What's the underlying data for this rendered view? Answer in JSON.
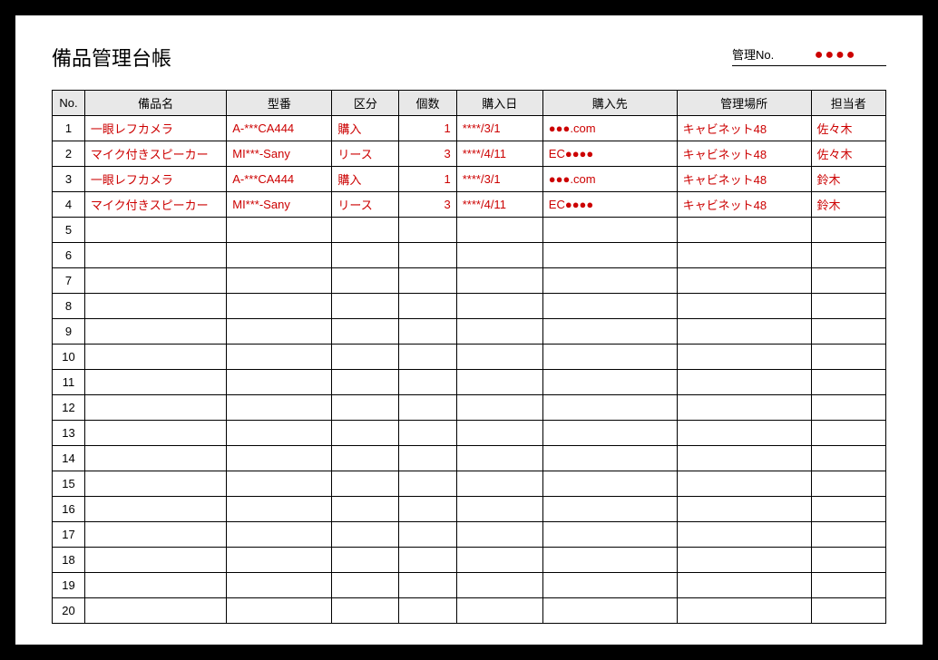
{
  "title": "備品管理台帳",
  "management_no_label": "管理No.",
  "management_no_value": "●●●●",
  "headers": {
    "no": "No.",
    "name": "備品名",
    "model": "型番",
    "category": "区分",
    "qty": "個数",
    "date": "購入日",
    "shop": "購入先",
    "location": "管理場所",
    "owner": "担当者"
  },
  "total_rows": 20,
  "rows": [
    {
      "no": "1",
      "name": "一眼レフカメラ",
      "model": "A-***CA444",
      "category": "購入",
      "qty": "1",
      "date": "****/3/1",
      "shop": "●●●.com",
      "location": "キャビネット48",
      "owner": "佐々木"
    },
    {
      "no": "2",
      "name": "マイク付きスピーカー",
      "model": "MI***-Sany",
      "category": "リース",
      "qty": "3",
      "date": "****/4/11",
      "shop": "EC●●●●",
      "location": "キャビネット48",
      "owner": "佐々木"
    },
    {
      "no": "3",
      "name": "一眼レフカメラ",
      "model": "A-***CA444",
      "category": "購入",
      "qty": "1",
      "date": "****/3/1",
      "shop": "●●●.com",
      "location": "キャビネット48",
      "owner": "鈴木"
    },
    {
      "no": "4",
      "name": "マイク付きスピーカー",
      "model": "MI***-Sany",
      "category": "リース",
      "qty": "3",
      "date": "****/4/11",
      "shop": "EC●●●●",
      "location": "キャビネット48",
      "owner": "鈴木"
    }
  ]
}
